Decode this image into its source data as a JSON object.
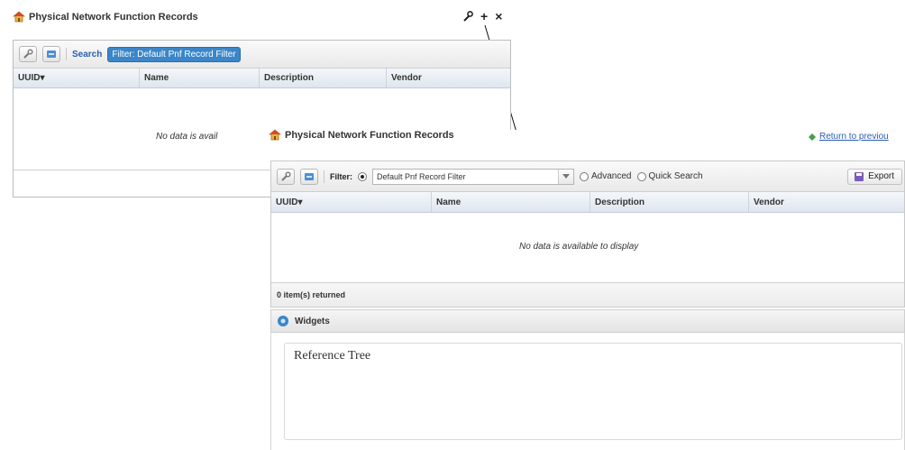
{
  "back_window": {
    "title": "Physical Network Function Records",
    "search_label": "Search",
    "filter_chip": "Filter: Default Pnf Record Filter",
    "columns": [
      "UUID▾",
      "Name",
      "Description",
      "Vendor"
    ],
    "no_data_text": "No data is avail"
  },
  "window_controls": {
    "wrench": "✎",
    "plus": "+",
    "close": "×"
  },
  "front_window": {
    "title": "Physical Network Function Records",
    "return_link": "Return to previou",
    "filter_label": "Filter:",
    "filter_value": "Default Pnf Record Filter",
    "radio_advanced": "Advanced",
    "radio_quick": "Quick Search",
    "export_label": "Export",
    "columns": [
      "UUID▾",
      "Name",
      "Description",
      "Vendor"
    ],
    "no_data_text": "No data is available to display",
    "items_returned": "0 item(s) returned",
    "widgets_title": "Widgets",
    "reference_tree": "Reference Tree"
  },
  "colors": {
    "accent": "#3a86c8",
    "link": "#2a5db0",
    "return_icon": "#43a047"
  }
}
